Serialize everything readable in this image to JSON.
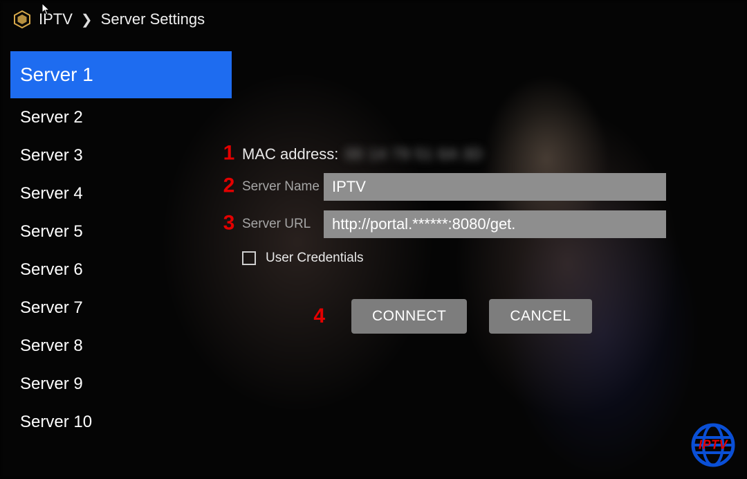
{
  "breadcrumb": {
    "app": "IPTV",
    "page": "Server Settings"
  },
  "sidebar": {
    "items": [
      {
        "label": "Server 1",
        "selected": true
      },
      {
        "label": "Server 2",
        "selected": false
      },
      {
        "label": "Server 3",
        "selected": false
      },
      {
        "label": "Server 4",
        "selected": false
      },
      {
        "label": "Server 5",
        "selected": false
      },
      {
        "label": "Server 6",
        "selected": false
      },
      {
        "label": "Server 7",
        "selected": false
      },
      {
        "label": "Server 8",
        "selected": false
      },
      {
        "label": "Server 9",
        "selected": false
      },
      {
        "label": "Server 10",
        "selected": false
      }
    ]
  },
  "form": {
    "mac_label": "MAC address:",
    "mac_value": "00 14 79 51 6A 3D",
    "server_name_label": "Server Name",
    "server_name_value": "IPTV",
    "server_url_label": "Server URL",
    "server_url_value": "http://portal.******:8080/get.",
    "user_credentials_label": "User Credentials",
    "user_credentials_checked": false
  },
  "markers": {
    "m1": "1",
    "m2": "2",
    "m3": "3",
    "m4": "4"
  },
  "buttons": {
    "connect": "CONNECT",
    "cancel": "CANCEL"
  },
  "brand": {
    "text": "IPTV"
  },
  "colors": {
    "accent_blue": "#1e6cf0",
    "marker_red": "#e30000",
    "input_gray": "#8e8e8e",
    "button_gray": "#7d7d7d"
  }
}
